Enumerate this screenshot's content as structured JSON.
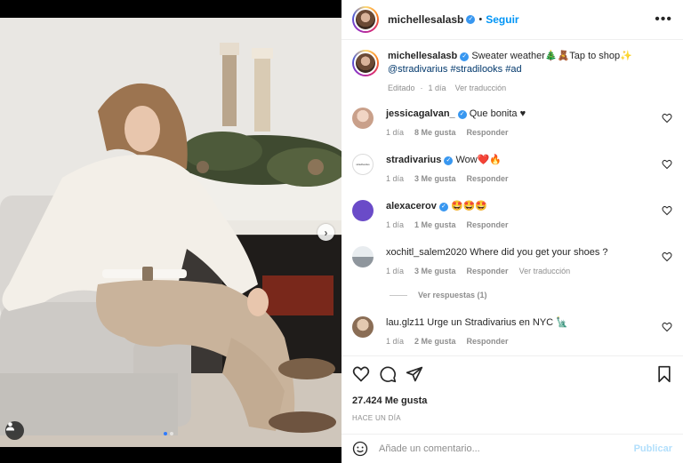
{
  "header": {
    "username": "michellesalasb",
    "follow_label": "Seguir",
    "more_label": "•••"
  },
  "caption": {
    "username": "michellesalasb",
    "text": "Sweater weather🎄🧸Tap to shop✨",
    "mention": "@stradivarius",
    "hashtags": "#stradilooks #ad",
    "edited": "Editado",
    "age": "1 día",
    "translate": "Ver traducción"
  },
  "comments": [
    {
      "username": "jessicagalvan_",
      "verified": true,
      "text": "Que bonita ♥",
      "age": "1 día",
      "likes": "8 Me gusta",
      "reply": "Responder",
      "avatar_color": "#c9a08a"
    },
    {
      "username": "stradivarius",
      "verified": true,
      "text": "Wow❤️🔥",
      "age": "1 día",
      "likes": "3 Me gusta",
      "reply": "Responder",
      "avatar_color": "#ffffff"
    },
    {
      "username": "alexacerov",
      "verified": true,
      "text": "🤩🤩🤩",
      "age": "1 día",
      "likes": "1 Me gusta",
      "reply": "Responder",
      "avatar_color": "#6a4bc8"
    },
    {
      "username": "xochitl_salem2020",
      "verified": false,
      "text": "Where did you get your shoes ?",
      "age": "1 día",
      "likes": "3 Me gusta",
      "reply": "Responder",
      "translate": "Ver traducción",
      "avatar_color": "#a8b0b8"
    },
    {
      "username": "lau.glz11",
      "verified": false,
      "text": "Urge un Stradivarius en NYC 🗽",
      "age": "1 día",
      "likes": "2 Me gusta",
      "reply": "Responder",
      "avatar_color": "#b79a80"
    }
  ],
  "view_replies": "Ver respuestas (1)",
  "stradivarius_avatar_text": "stradivarius",
  "likes_count": "27.424 Me gusta",
  "timestamp": "HACE UN DÍA",
  "add_comment": {
    "placeholder": "Añade un comentario...",
    "publish_label": "Publicar"
  },
  "colors": {
    "accent": "#0095f6",
    "verified": "#3897f0",
    "muted": "#8e8e8e",
    "link": "#00376b",
    "publish_disabled": "#b2dffc",
    "carousel_active_dot": "#2f7bff"
  },
  "icons": [
    "heart-icon",
    "comment-icon",
    "share-icon",
    "save-icon",
    "emoji-icon",
    "user-tag-icon",
    "chevron-right-icon",
    "more-icon",
    "verified-badge-icon"
  ]
}
